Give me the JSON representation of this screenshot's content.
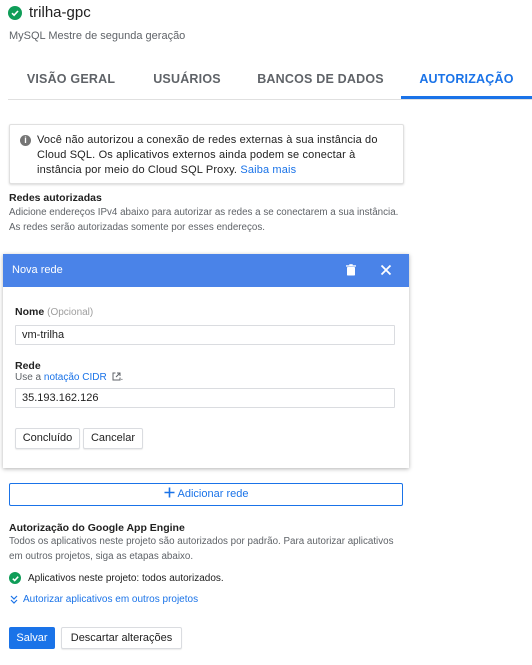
{
  "header": {
    "instance_name": "trilha-gpc",
    "subtitle": "MySQL Mestre de segunda geração",
    "status_color": "#0f9d58"
  },
  "tabs": [
    {
      "label": "VISÃO GERAL",
      "active": false
    },
    {
      "label": "USUÁRIOS",
      "active": false
    },
    {
      "label": "BANCOS DE DADOS",
      "active": false
    },
    {
      "label": "AUTORIZAÇÃO",
      "active": true
    }
  ],
  "info_box": {
    "icon": "info-icon",
    "text": "Você não autorizou a conexão de redes externas à sua instância do Cloud SQL. Os aplicativos externos ainda podem se conectar à instância por meio do Cloud SQL Proxy. ",
    "link": "Saiba mais"
  },
  "authorized_networks": {
    "heading": "Redes autorizadas",
    "description": "Adicione endereços IPv4 abaixo para autorizar as redes a se conectarem a sua instância. As redes serão autorizadas somente por esses endereços."
  },
  "new_network_card": {
    "title": "Nova rede",
    "header_color": "#4a83e8",
    "name_label": "Nome",
    "name_optional": "(Opcional)",
    "name_value": "vm-trilha",
    "network_label": "Rede",
    "hint_prefix": "Use a ",
    "hint_link": "notação CIDR",
    "hint_suffix": ".",
    "network_value": "35.193.162.126",
    "done_label": "Concluído",
    "cancel_label": "Cancelar"
  },
  "add_network_label": "Adicionar rede",
  "app_engine": {
    "heading": "Autorização do Google App Engine",
    "description": "Todos os aplicativos neste projeto são autorizados por padrão. Para autorizar aplicativos em outros projetos, siga as etapas abaixo.",
    "status_text": "Aplicativos neste projeto: todos autorizados.",
    "expand_link": "Autorizar aplicativos em outros projetos"
  },
  "footer": {
    "save_label": "Salvar",
    "discard_label": "Descartar alterações"
  },
  "accent_color": "#1a73e8"
}
